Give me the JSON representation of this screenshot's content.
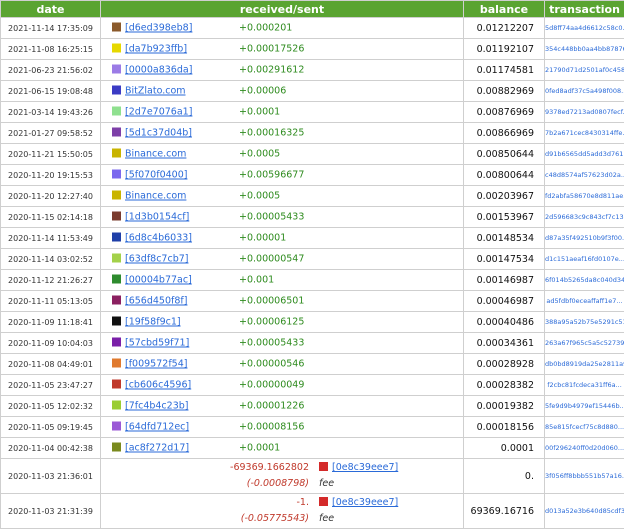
{
  "headers": {
    "date": "date",
    "received_sent": "received/sent",
    "balance": "balance",
    "transaction": "transaction"
  },
  "rows": [
    {
      "date": "2021-11-14 17:35:09",
      "addr": "[d6ed398eb8]",
      "color": "#8b5a2b",
      "amount": "+0.000201",
      "balance": "0.01212207",
      "tx": "5d8ff74aa4d6612c58c0..."
    },
    {
      "date": "2021-11-08 16:25:15",
      "addr": "[da7b923ffb]",
      "color": "#e6d800",
      "amount": "+0.00017526",
      "balance": "0.01192107",
      "tx": "354c448bb0aa4bb87876..."
    },
    {
      "date": "2021-06-23 21:56:02",
      "addr": "[0000a836da]",
      "color": "#9b7be6",
      "amount": "+0.00291612",
      "balance": "0.01174581",
      "tx": "21790d71d2501af0c458..."
    },
    {
      "date": "2021-06-15 19:08:48",
      "addr": "BitZlato.com",
      "color": "#3b3bc4",
      "amount": "+0.00006",
      "balance": "0.00882969",
      "tx": "0fed8adf37c5a498f008..."
    },
    {
      "date": "2021-03-14 19:43:26",
      "addr": "[2d7e7076a1]",
      "color": "#8fe08f",
      "amount": "+0.0001",
      "balance": "0.00876969",
      "tx": "9378ed7213ad0807fecf..."
    },
    {
      "date": "2021-01-27 09:58:52",
      "addr": "[5d1c37d04b]",
      "color": "#7d3fa8",
      "amount": "+0.00016325",
      "balance": "0.00866969",
      "tx": "7b2a671cec8430314ffe..."
    },
    {
      "date": "2020-11-21 15:50:05",
      "addr": "Binance.com",
      "color": "#c9b400",
      "amount": "+0.0005",
      "balance": "0.00850644",
      "tx": "d91b6565dd5add3d7611..."
    },
    {
      "date": "2020-11-20 19:15:53",
      "addr": "[5f070f0400]",
      "color": "#7b68ee",
      "amount": "+0.00596677",
      "balance": "0.00800644",
      "tx": "c48d8574af57623d02a..."
    },
    {
      "date": "2020-11-20 12:27:40",
      "addr": "Binance.com",
      "color": "#c9b400",
      "amount": "+0.0005",
      "balance": "0.00203967",
      "tx": "fd2abfa58670e8d811ae..."
    },
    {
      "date": "2020-11-15 02:14:18",
      "addr": "[1d3b0154cf]",
      "color": "#7a3b2e",
      "amount": "+0.00005433",
      "balance": "0.00153967",
      "tx": "2d596683c9c843cf7c13..."
    },
    {
      "date": "2020-11-14 11:53:49",
      "addr": "[6d8c4b6033]",
      "color": "#1f3fa8",
      "amount": "+0.00001",
      "balance": "0.00148534",
      "tx": "d87a35f492510b9f3f00..."
    },
    {
      "date": "2020-11-14 03:02:52",
      "addr": "[63df8c7cb7]",
      "color": "#a3d14a",
      "amount": "+0.00000547",
      "balance": "0.00147534",
      "tx": "d1c151aeaf16fd0107e..."
    },
    {
      "date": "2020-11-12 21:26:27",
      "addr": "[00004b77ac]",
      "color": "#2e8b2e",
      "amount": "+0.001",
      "balance": "0.00146987",
      "tx": "6f014b5265da8c040d34..."
    },
    {
      "date": "2020-11-11 05:13:05",
      "addr": "[656d450f8f]",
      "color": "#8b2060",
      "amount": "+0.00006501",
      "balance": "0.00046987",
      "tx": "ad5fdbf0eceaffaff1e7..."
    },
    {
      "date": "2020-11-09 11:18:41",
      "addr": "[19f58f9c1]",
      "color": "#101010",
      "amount": "+0.00006125",
      "balance": "0.00040486",
      "tx": "388a95a52b75e5291c51..."
    },
    {
      "date": "2020-11-09 10:04:03",
      "addr": "[57cbd59f71]",
      "color": "#7a1fa8",
      "amount": "+0.00005433",
      "balance": "0.00034361",
      "tx": "263a67f965c5a5c52739..."
    },
    {
      "date": "2020-11-08 04:49:01",
      "addr": "[f009572f54]",
      "color": "#e07a2e",
      "amount": "+0.00000546",
      "balance": "0.00028928",
      "tx": "db0bd8919da25e2811a9..."
    },
    {
      "date": "2020-11-05 23:47:27",
      "addr": "[cb606c4596]",
      "color": "#c0392b",
      "amount": "+0.00000049",
      "balance": "0.00028382",
      "tx": "f2cbc81fcdeca31ff6a..."
    },
    {
      "date": "2020-11-05 12:02:32",
      "addr": "[7fc4b4c23b]",
      "color": "#9acd32",
      "amount": "+0.00001226",
      "balance": "0.00019382",
      "tx": "5fe9d9b4979ef15446b..."
    },
    {
      "date": "2020-11-05 09:19:45",
      "addr": "[64dfd712ec]",
      "color": "#9b59d6",
      "amount": "+0.00008156",
      "balance": "0.00018156",
      "tx": "85e815fcecf75c8d880..."
    },
    {
      "date": "2020-11-04 00:42:38",
      "addr": "[ac8f272d17]",
      "color": "#7a8a1e",
      "amount": "+0.0001",
      "balance": "0.0001",
      "tx": "00f296240ff0d20d060..."
    }
  ],
  "sent_rows": [
    {
      "date": "2020-11-03 21:36:01",
      "amount": "-69369.1662802",
      "fee": "(-0.0008798)",
      "addr": "[0e8c39eee7]",
      "fee_label": "fee",
      "color": "#d42a2a",
      "balance": "0.",
      "tx": "3f056ff8bbb551b57a16..."
    },
    {
      "date": "2020-11-03 21:31:39",
      "amount": "-1.",
      "fee": "(-0.05775543)",
      "addr": "[0e8c39eee7]",
      "fee_label": "fee",
      "color": "#d42a2a",
      "balance": "69369.16716",
      "tx": "d013a52e3b640d85cdf3..."
    }
  ]
}
